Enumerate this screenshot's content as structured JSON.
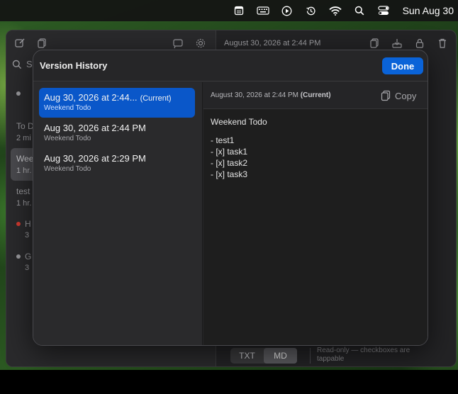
{
  "menubar": {
    "icons": [
      "notes-app-icon",
      "keyboard-icon",
      "play-icon",
      "time-machine-icon",
      "wifi-icon",
      "spotlight-search-icon",
      "control-center-icon"
    ],
    "clock": "Sun Aug 30"
  },
  "app": {
    "detail_date": "August 30, 2026 at 2:44 PM",
    "search_placeholder": "S",
    "sidebar_items": [
      {
        "line1": "To D",
        "line2": "2 mi"
      },
      {
        "line1": "Wee",
        "line2": "1 hr."
      },
      {
        "line1": "test",
        "line2": "1 hr."
      },
      {
        "line1": "H",
        "line2": "3"
      },
      {
        "line1": "G",
        "line2": "3"
      }
    ],
    "footer": {
      "segments": [
        "TXT",
        "MD"
      ],
      "active_segment": "MD",
      "note": "Read-only — checkboxes are tappable"
    }
  },
  "sheet": {
    "title": "Version History",
    "done_label": "Done",
    "versions": [
      {
        "title": "Aug 30, 2026 at 2:44...",
        "current_label": "(Current)",
        "subtitle": "Weekend Todo",
        "selected": true
      },
      {
        "title": "Aug 30, 2026 at 2:44 PM",
        "current_label": "",
        "subtitle": "Weekend Todo",
        "selected": false
      },
      {
        "title": "Aug 30, 2026 at 2:29 PM",
        "current_label": "",
        "subtitle": "Weekend Todo",
        "selected": false
      }
    ],
    "preview": {
      "date": "August 30, 2026 at 2:44 PM",
      "current_label": "(Current)",
      "copy_label": "Copy",
      "lines": [
        "Weekend Todo",
        "- test1",
        "- [x] task1",
        "- [x] task2",
        "- [x] task3"
      ]
    }
  },
  "colors": {
    "accent": "#0a63d8",
    "selected_row": "#0a57c9",
    "red_dot": "#d23a30"
  }
}
